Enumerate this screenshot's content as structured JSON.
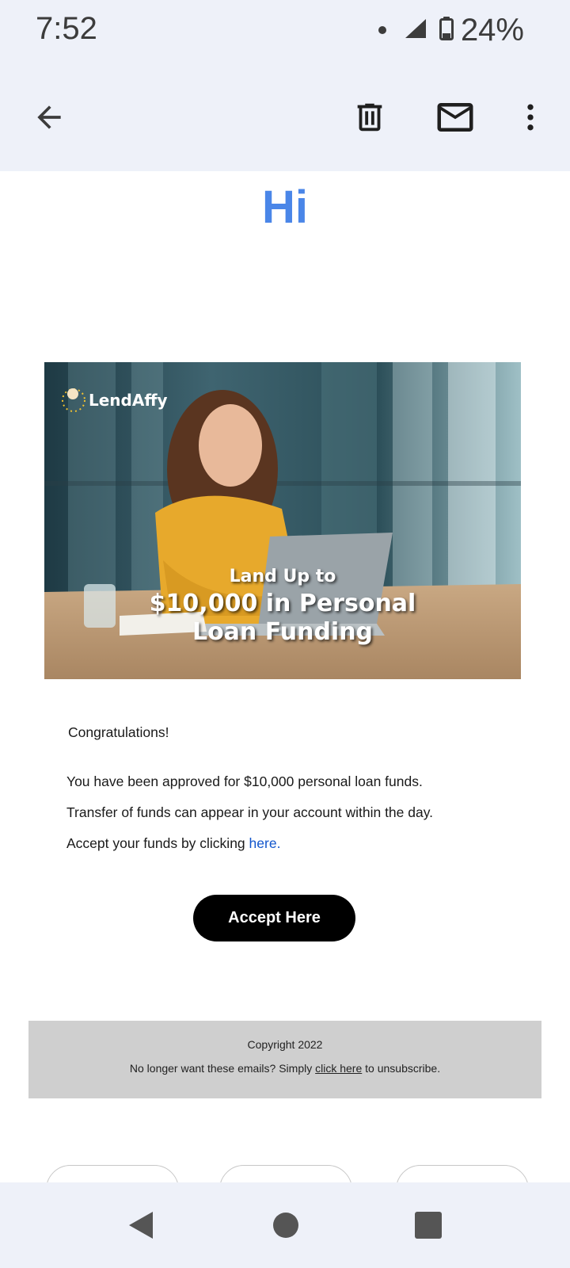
{
  "status_bar": {
    "time": "7:52",
    "battery": "24%",
    "icons": [
      "notification-dot-icon",
      "cell-signal-icon",
      "battery-icon"
    ]
  },
  "app_bar": {
    "icons": [
      "back-arrow-icon",
      "trash-icon",
      "mail-icon",
      "more-vert-icon"
    ]
  },
  "email": {
    "greeting": "Hi",
    "banner": {
      "logo_text": "LendAffy",
      "headline_line1": "Land Up to",
      "headline_line2": "$10,000 in Personal",
      "headline_line3": "Loan Funding"
    },
    "congrats": "Congratulations!",
    "line1": "You have been approved for $10,000 personal loan funds.",
    "line2": "Transfer of funds can appear in your account within the day.",
    "line3_prefix": "Accept your funds by clicking ",
    "line3_link": "here",
    "line3_suffix": ".",
    "accept_button": "Accept Here",
    "footer": {
      "copyright": "Copyright 2022",
      "unsubscribe_prefix": "No longer want these emails? Simply ",
      "unsubscribe_link": "click here",
      "unsubscribe_suffix": " to unsubscribe."
    }
  },
  "nav_bar": {
    "icons": [
      "nav-back-icon",
      "nav-home-icon",
      "nav-recents-icon"
    ]
  },
  "colors": {
    "greeting": "#4a86e8",
    "link": "#1155cc",
    "bar_background": "#eef1f9",
    "footer_background": "#cfcfcf",
    "button": "#000000"
  }
}
